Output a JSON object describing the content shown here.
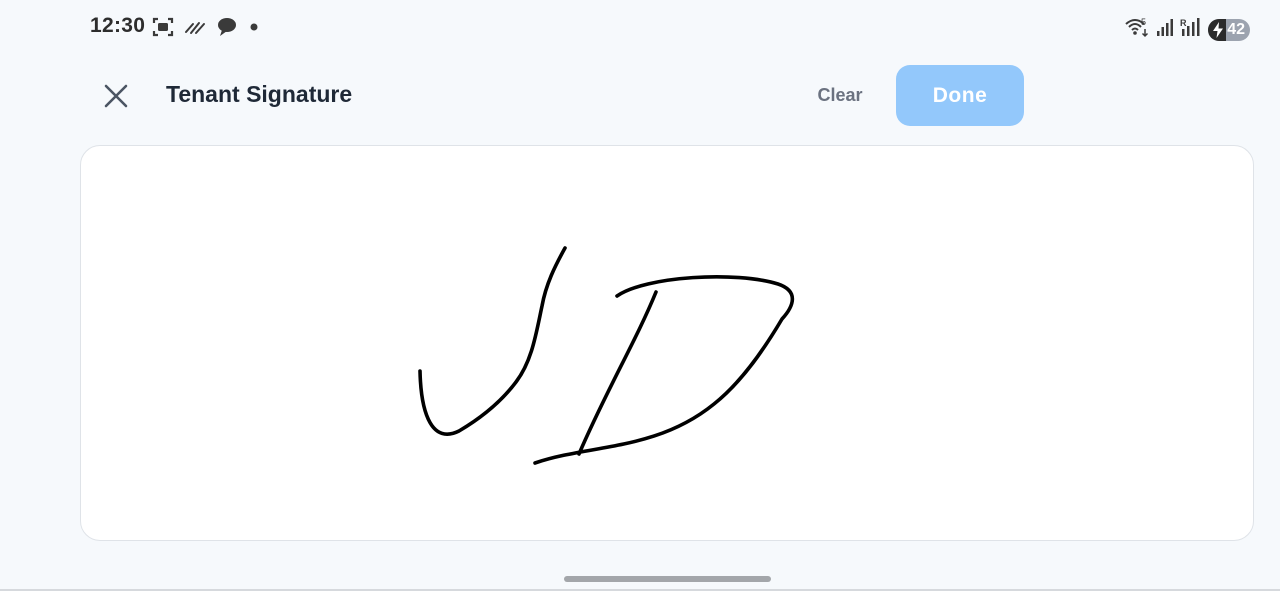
{
  "status_bar": {
    "time": "12:30",
    "left_icons": [
      "screenshot-icon",
      "stylus-icon",
      "chat-bubble-icon",
      "notification-dot-icon"
    ],
    "right_icons": [
      "wifi-icon",
      "cellular-signal-icon",
      "cellular-signal-icon"
    ],
    "wifi_badge": "5",
    "signal_badge": "R",
    "battery_level": "42",
    "battery_charging": true
  },
  "header": {
    "title": "Tenant Signature",
    "clear_label": "Clear",
    "done_label": "Done"
  },
  "colors": {
    "background": "#f6f9fc",
    "done_button": "#93c8fb",
    "ink": "#000000"
  }
}
